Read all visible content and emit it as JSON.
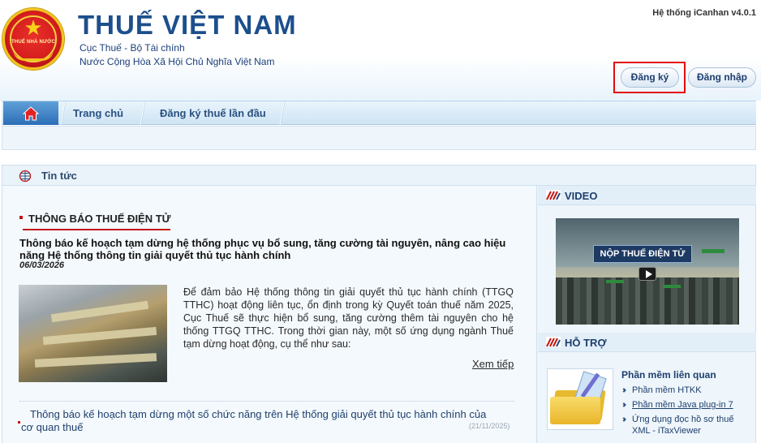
{
  "header": {
    "emblem_text": "THUẾ NHÀ NƯỚC",
    "title": "THUẾ VIỆT NAM",
    "subtitle1": "Cục Thuế - Bộ Tài chính",
    "subtitle2": "Nước Cộng Hòa Xã Hội Chủ Nghĩa Việt Nam",
    "system_version": "Hệ thống iCanhan v4.0.1",
    "register_label": "Đăng ký",
    "login_label": "Đăng nhập",
    "highlight_color": "#e30b0b"
  },
  "nav": {
    "items": [
      "Trang chủ",
      "Đăng ký thuế lần đầu"
    ]
  },
  "news": {
    "section_header": "Tin tức",
    "category_title": "THÔNG BÁO THUẾ ĐIỆN TỬ",
    "featured": {
      "headline": "Thông báo kế hoạch tạm dừng hệ thống phục vụ bổ sung, tăng cường tài nguyên, nâng cao hiệu năng Hệ thống thông tin giải quyết thủ tục hành chính",
      "date": "06/03/2026",
      "excerpt": "Để đảm bảo Hệ thống thông tin giải quyết thủ tục hành chính (TTGQ TTHC) hoạt động liên tục, ổn định trong kỳ Quyết toán thuế năm 2025, Cục Thuế sẽ thực hiện bổ sung, tăng cường thêm tài nguyên cho hệ thống TTGQ TTHC. Trong thời gian này, một số ứng dụng ngành Thuế tạm dừng hoạt động, cụ thể như sau:",
      "read_more": "Xem tiếp"
    },
    "other": [
      {
        "title": "Thông báo kế hoạch tạm dừng một số chức năng trên Hệ thống giải quyết thủ tục hành chính của cơ quan thuế",
        "date": "(21/11/2025)"
      }
    ]
  },
  "sidebar": {
    "video_title": "VIDEO",
    "video_banner": "NỘP THUẾ ĐIỆN TỬ",
    "support_title": "HỖ TRỢ",
    "support_heading": "Phần mềm liên quan",
    "support_items": [
      "Phần mềm HTKK",
      "Phần mềm Java plug-in 7",
      "Ứng dụng đọc hồ sơ thuế XML - iTaxViewer"
    ]
  }
}
